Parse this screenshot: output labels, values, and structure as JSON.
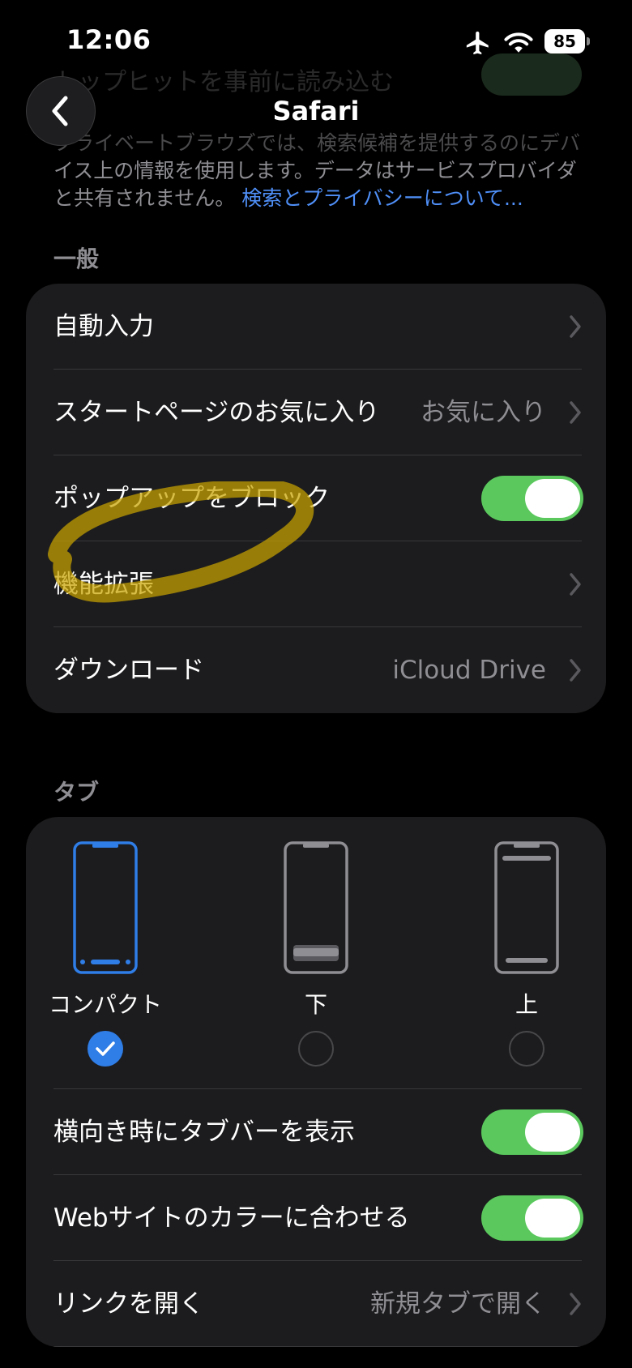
{
  "status_bar": {
    "time": "12:06",
    "battery": "85"
  },
  "background_ghost": {
    "text": "トップヒットを事前に読み込む"
  },
  "nav": {
    "back_label": "",
    "title": "Safari"
  },
  "footnote": {
    "line1": "プライベートブラウズでは、検索候補を提供するのにデバ",
    "line2": "イス上の情報を使用します。データはサービスプロバイダ",
    "line3": "と共有されません。",
    "link": "検索とプライバシーについて..."
  },
  "general": {
    "header": "一般",
    "rows": [
      {
        "label": "自動入力",
        "value": "",
        "type": "link"
      },
      {
        "label": "スタートページのお気に入り",
        "value": "お気に入り",
        "type": "link"
      },
      {
        "label": "ポップアップをブロック",
        "type": "toggle",
        "on": true
      },
      {
        "label": "機能拡張",
        "value": "",
        "type": "link"
      },
      {
        "label": "ダウンロード",
        "value": "iCloud Drive",
        "type": "link"
      }
    ]
  },
  "tabs": {
    "header": "タブ",
    "layouts": [
      {
        "label": "コンパクト",
        "selected": true
      },
      {
        "label": "下",
        "selected": false
      },
      {
        "label": "上",
        "selected": false
      }
    ],
    "rows": [
      {
        "label": "横向き時にタブバーを表示",
        "type": "toggle",
        "on": true
      },
      {
        "label": "Webサイトのカラーに合わせる",
        "type": "toggle",
        "on": true
      },
      {
        "label": "リンクを開く",
        "value": "新規タブで開く",
        "type": "link"
      }
    ]
  },
  "colors": {
    "accent": "#2f7de6",
    "toggle_on": "#5ac85d",
    "link": "#4f8ff7",
    "highlight_marker": "#c9a400"
  },
  "icons": [
    "chevron-left-icon",
    "airplane-icon",
    "wifi-icon",
    "battery-icon",
    "chevron-right-icon",
    "checkmark-icon",
    "phone-compact-icon",
    "phone-bottom-icon",
    "phone-top-icon"
  ]
}
